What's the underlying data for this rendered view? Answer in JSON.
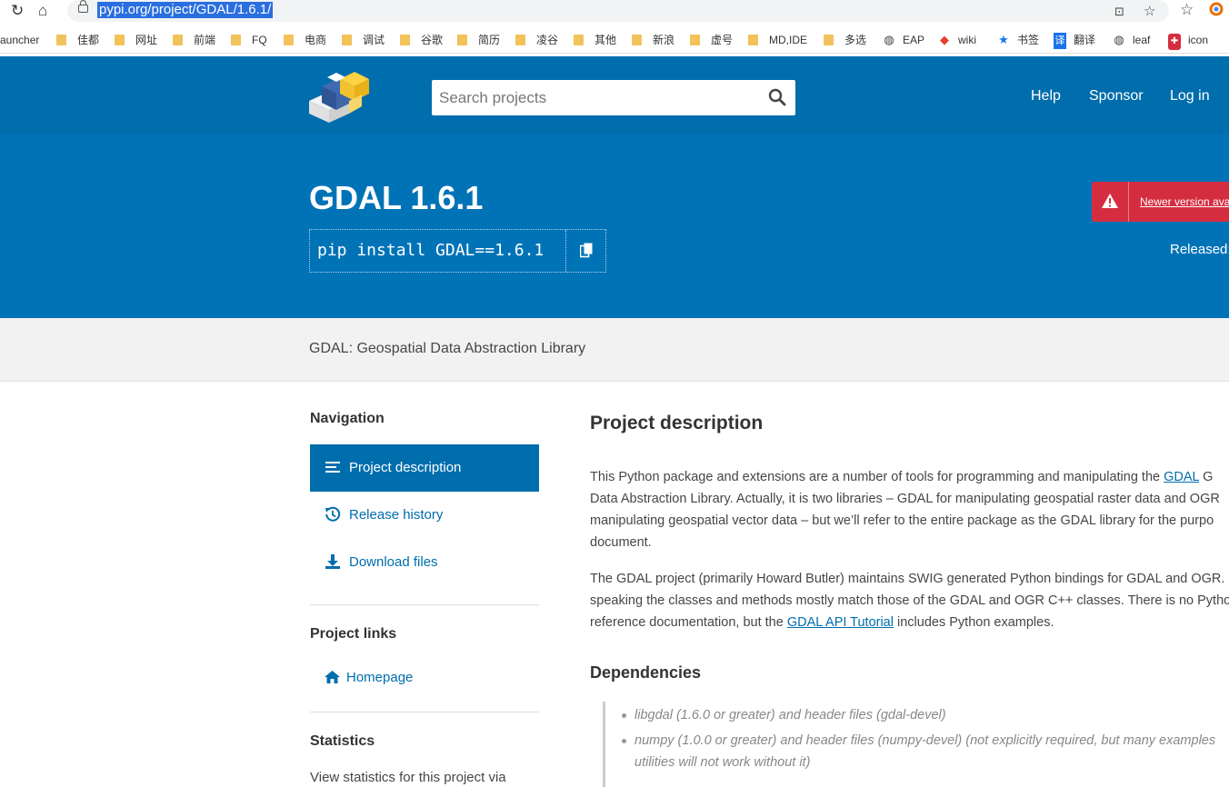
{
  "browser": {
    "url": "pypi.org/project/GDAL/1.6.1/",
    "bookmarks": [
      {
        "label": "auncher",
        "icon": "none"
      },
      {
        "label": "佳都",
        "icon": "folder"
      },
      {
        "label": "网址",
        "icon": "folder"
      },
      {
        "label": "前端",
        "icon": "folder"
      },
      {
        "label": "FQ",
        "icon": "folder"
      },
      {
        "label": "电商",
        "icon": "folder"
      },
      {
        "label": "调试",
        "icon": "folder"
      },
      {
        "label": "谷歌",
        "icon": "folder"
      },
      {
        "label": "简历",
        "icon": "folder"
      },
      {
        "label": "凌谷",
        "icon": "folder"
      },
      {
        "label": "其他",
        "icon": "folder"
      },
      {
        "label": "新浪",
        "icon": "folder"
      },
      {
        "label": "虚号",
        "icon": "folder"
      },
      {
        "label": "MD,IDE",
        "icon": "folder"
      },
      {
        "label": "多选",
        "icon": "folder"
      },
      {
        "label": "EAP",
        "icon": "globe-icon"
      },
      {
        "label": "wiki",
        "icon": "gitlab-icon"
      },
      {
        "label": "书签",
        "icon": "star-icon"
      },
      {
        "label": "翻译",
        "icon": "translate-icon"
      },
      {
        "label": "leaf",
        "icon": "globe-icon"
      },
      {
        "label": "icon",
        "icon": "icon-site-icon"
      }
    ]
  },
  "header": {
    "search_placeholder": "Search projects",
    "links": [
      "Help",
      "Sponsor",
      "Log in"
    ]
  },
  "banner": {
    "title": "GDAL 1.6.1",
    "pip_command": "pip install GDAL==1.6.1",
    "warning_link": "Newer version ava",
    "released_label": "Released:"
  },
  "summary": "GDAL: Geospatial Data Abstraction Library",
  "sidebar": {
    "navigation_heading": "Navigation",
    "nav_items": [
      {
        "label": "Project description",
        "icon": "list-icon",
        "active": true
      },
      {
        "label": "Release history",
        "icon": "history-icon",
        "active": false
      },
      {
        "label": "Download files",
        "icon": "download-icon",
        "active": false
      }
    ],
    "project_links_heading": "Project links",
    "homepage_label": "Homepage",
    "statistics_heading": "Statistics",
    "statistics_text": "View statistics for this project via"
  },
  "main": {
    "heading": "Project description",
    "para1": {
      "before": "This Python package and extensions are a number of tools for programming and manipulating the ",
      "link": "GDAL",
      "after": " G"
    },
    "para1_lines": [
      "Data Abstraction Library. Actually, it is two libraries – GDAL for manipulating geospatial raster data and OGR",
      "manipulating geospatial vector data – but we’ll refer to the entire package as the GDAL library for the purpo",
      "document."
    ],
    "para2_lines": [
      "The GDAL project (primarily Howard Butler) maintains SWIG generated Python bindings for GDAL and OGR.",
      "speaking the classes and methods mostly match those of the GDAL and OGR C++ classes. There is no Pytho"
    ],
    "para2_last": {
      "before": "reference documentation, but the ",
      "link": "GDAL API Tutorial",
      "after": " includes Python examples."
    },
    "dependencies_heading": "Dependencies",
    "dependencies": [
      "libgdal (1.6.0 or greater) and header files (gdal-devel)",
      "numpy (1.0.0 or greater) and header files (numpy-devel) (not explicitly required, but many examples",
      "utilities will not work without it)"
    ]
  },
  "colors": {
    "pypi_blue": "#006dad",
    "banner_blue": "#0073b7",
    "warning_red": "#d52d40"
  }
}
